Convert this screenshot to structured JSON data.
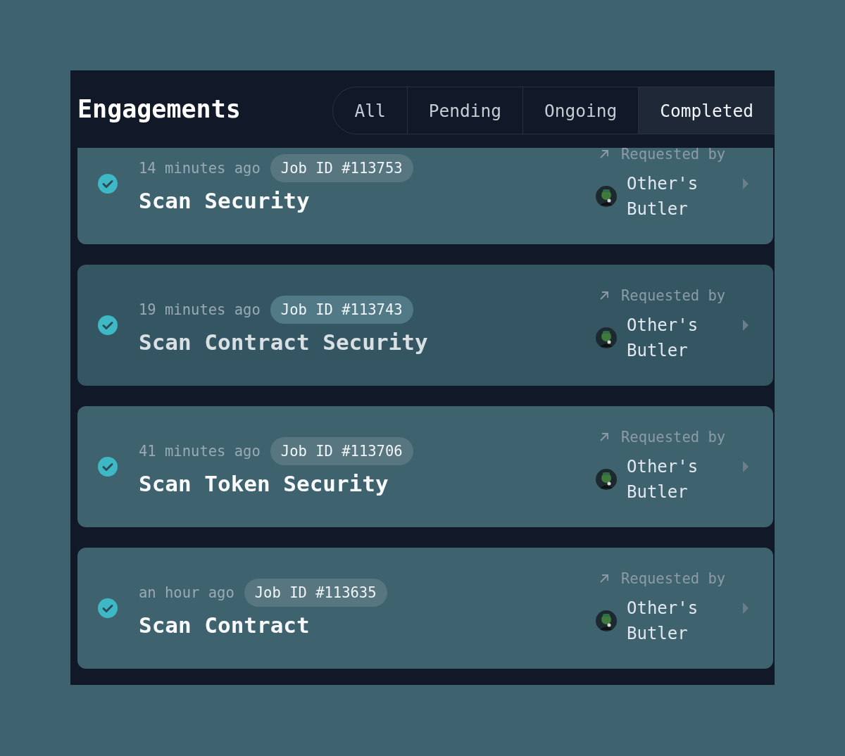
{
  "header": {
    "title": "Engagements"
  },
  "tabs": [
    {
      "label": "All",
      "selected": false
    },
    {
      "label": "Pending",
      "selected": false
    },
    {
      "label": "Ongoing",
      "selected": false
    },
    {
      "label": "Completed",
      "selected": true
    }
  ],
  "jobs": [
    {
      "time": "14 minutes ago",
      "job_id": "Job ID #113753",
      "title": "Scan Security",
      "requested_label": "Requested by",
      "requester": "Other's Butler",
      "completed": true,
      "hovered": false
    },
    {
      "time": "19 minutes ago",
      "job_id": "Job ID #113743",
      "title": "Scan Contract Security",
      "requested_label": "Requested by",
      "requester": "Other's Butler",
      "completed": true,
      "hovered": true
    },
    {
      "time": "41 minutes ago",
      "job_id": "Job ID #113706",
      "title": "Scan Token Security",
      "requested_label": "Requested by",
      "requester": "Other's Butler",
      "completed": true,
      "hovered": false
    },
    {
      "time": "an hour ago",
      "job_id": "Job ID #113635",
      "title": "Scan Contract",
      "requested_label": "Requested by",
      "requester": "Other's Butler",
      "completed": true,
      "hovered": false
    }
  ]
}
